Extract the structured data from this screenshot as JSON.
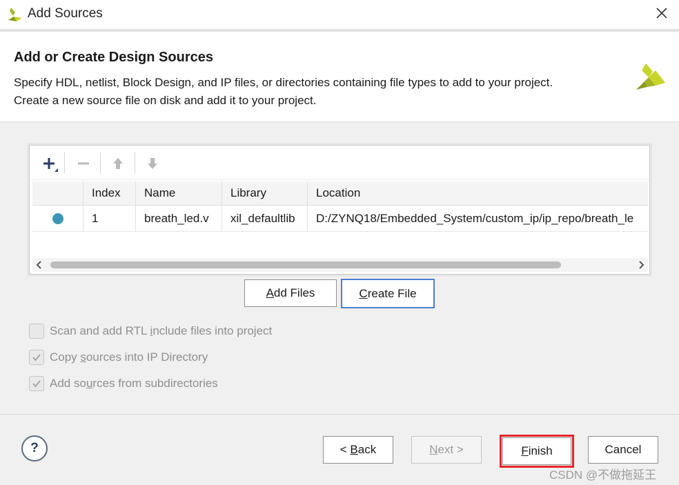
{
  "window": {
    "title": "Add Sources",
    "close_icon": "close-icon"
  },
  "header": {
    "heading": "Add or Create Design Sources",
    "description_line1": "Specify HDL, netlist, Block Design, and IP files, or directories containing file types to add to your project.",
    "description_line2": "Create a new source file on disk and add it to your project.",
    "logo_icon": "xilinx-logo-icon"
  },
  "toolbar": {
    "add_icon": "plus-icon",
    "remove_icon": "minus-icon",
    "move_up_icon": "arrow-up-icon",
    "move_down_icon": "arrow-down-icon"
  },
  "table": {
    "columns": [
      "",
      "Index",
      "Name",
      "Library",
      "Location"
    ],
    "rows": [
      {
        "status_icon": "status-dot-icon",
        "index": "1",
        "name": "breath_led.v",
        "library": "xil_defaultlib",
        "location": "D:/ZYNQ18/Embedded_System/custom_ip/ip_repo/breath_le"
      }
    ]
  },
  "buttons": {
    "add_files": {
      "underlined": "A",
      "rest": "dd Files"
    },
    "create_file": {
      "underlined": "C",
      "rest": "reate File"
    },
    "back": {
      "prefix": "< ",
      "underlined": "B",
      "rest": "ack"
    },
    "next": {
      "underlined": "N",
      "rest": "ext >"
    },
    "finish": {
      "underlined": "F",
      "rest": "inish"
    },
    "cancel": "Cancel",
    "help": "?"
  },
  "options": [
    {
      "before": "Scan and add RTL ",
      "underlined": "i",
      "after": "nclude files into project",
      "checked": false
    },
    {
      "before": "Copy ",
      "underlined": "s",
      "after": "ources into IP Directory",
      "checked": true
    },
    {
      "before": "Add so",
      "underlined": "u",
      "after": "rces from subdirectories",
      "checked": true
    }
  ],
  "watermark": "CSDN @不做拖延王",
  "colors": {
    "accent_blue": "#4a7fd0",
    "status_dot": "#3b95b5",
    "highlight_red": "#e8242a",
    "logo_yellow": "#c7d42a",
    "logo_green": "#8a9a1e"
  }
}
